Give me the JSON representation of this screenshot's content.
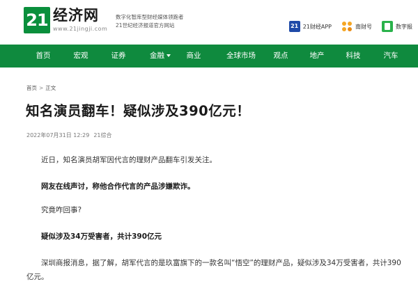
{
  "header": {
    "logo_badge": "21",
    "logo_name": "经济网",
    "logo_url": "www.21jingji.com",
    "slogan_line1": "数字化智库型财经媒体领跑者",
    "slogan_line2": "21世纪经济报道官方网站",
    "links": [
      {
        "icon": "app-21-icon",
        "label": "21财经APP"
      },
      {
        "icon": "nancai-icon",
        "label": "南财号"
      },
      {
        "icon": "shuzibao-icon",
        "label": "数字报"
      }
    ],
    "colors": {
      "brand_green": "#0f8a3e"
    }
  },
  "nav": {
    "items": [
      "首页",
      "宏观",
      "证券",
      "金融",
      "商业",
      "全球市场",
      "观点",
      "地产",
      "科技",
      "汽车"
    ]
  },
  "breadcrumb": {
    "home": "首页",
    "separator": ">",
    "current": "正文"
  },
  "article": {
    "title": "知名演员翻车！疑似涉及390亿元！",
    "date": "2022年07月31日 12:29",
    "source": "21综合",
    "paragraphs": [
      {
        "text": "近日，知名演员胡军因代言的理财产品翻车引发关注。",
        "bold": false
      },
      {
        "text": "网友在线声讨，称他合作代言的产品涉嫌欺诈。",
        "bold": true
      },
      {
        "text": "究竟咋回事?",
        "bold": false
      },
      {
        "text": "疑似涉及34万受害者，共计390亿元",
        "bold": true
      },
      {
        "text": "深圳商报消息，据了解，胡军代言的是玖富旗下的一款名叫“悟空”的理财产品，疑似涉及34万受害者，共计390亿元。",
        "bold": false
      }
    ]
  }
}
